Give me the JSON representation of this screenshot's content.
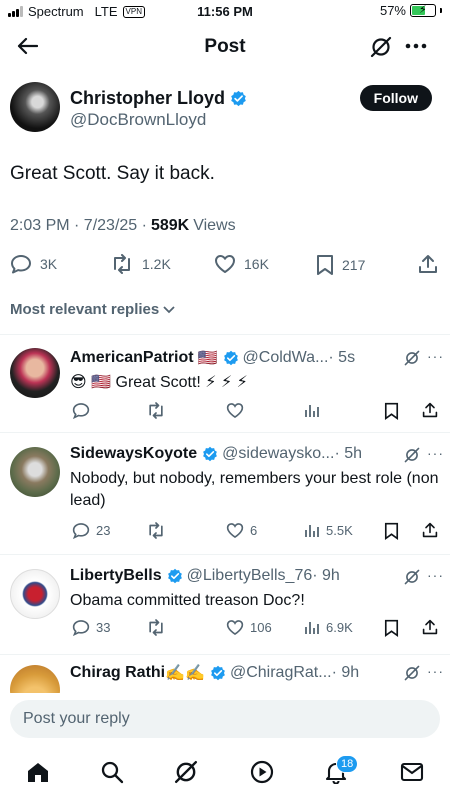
{
  "status_bar": {
    "carrier": "Spectrum",
    "network": "LTE",
    "vpn": "VPN",
    "time": "11:56 PM",
    "battery": "57%",
    "battery_level": 0.57
  },
  "header": {
    "title": "Post"
  },
  "author": {
    "name": "Christopher Lloyd",
    "handle": "@DocBrownLloyd",
    "follow_label": "Follow"
  },
  "tweet": {
    "text": "Great Scott. Say it back.",
    "timestamp": "2:03 PM · 7/23/25 ·",
    "views_count": "589K",
    "views_label": "Views",
    "replies": "3K",
    "reposts": "1.2K",
    "likes": "16K",
    "bookmarks": "217"
  },
  "sort_label": "Most relevant replies",
  "replies": [
    {
      "name": "AmericanPatriot",
      "flag": "🇺🇸",
      "handle": "@ColdWa...",
      "time": "· 5s",
      "text": "😎 🇺🇸 Great Scott! ⚡ ⚡ ⚡",
      "reply_count": "",
      "like_count": "",
      "view_count": ""
    },
    {
      "name": "SidewaysKoyote",
      "handle": "@sidewaysko...",
      "time": "· 5h",
      "text": "Nobody, but nobody, remembers your best role (non lead)",
      "reply_count": "23",
      "like_count": "6",
      "view_count": "5.5K"
    },
    {
      "name": "LibertyBells",
      "handle": "@LibertyBells_76",
      "time": "· 9h",
      "text": "Obama committed treason Doc?!",
      "reply_count": "33",
      "like_count": "106",
      "view_count": "6.9K"
    },
    {
      "name": "Chirag Rathi",
      "name_emoji": "✍️✍️",
      "handle": "@ChiragRat...",
      "time": "· 9h"
    }
  ],
  "compose": {
    "placeholder": "Post your reply"
  },
  "nav": {
    "notifications_badge": "18"
  },
  "colors": {
    "verified": "#1d9bf0",
    "text": "#0f1419",
    "muted": "#536471",
    "accent": "#1d9bf0"
  }
}
